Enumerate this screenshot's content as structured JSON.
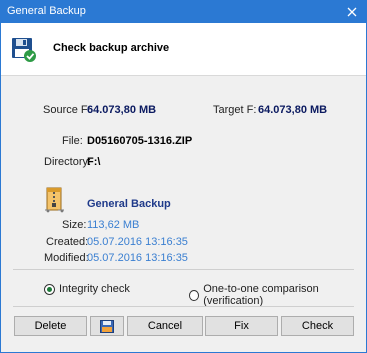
{
  "window": {
    "title": "General Backup"
  },
  "header": {
    "title": "Check backup archive"
  },
  "summary": {
    "source_label": "Source F:",
    "source_value": "64.073,80 MB",
    "target_label": "Target F:",
    "target_value": "64.073,80 MB",
    "file_label": "File:",
    "file_value": "D05160705-1316.ZIP",
    "directory_label": "Directory:",
    "directory_value": "F:\\"
  },
  "archive": {
    "name": "General Backup",
    "size_label": "Size:",
    "size_value": "113,62 MB",
    "created_label": "Created:",
    "created_value": "05.07.2016 13:16:35",
    "modified_label": "Modified:",
    "modified_value": "05.07.2016 13:16:35"
  },
  "options": {
    "integrity_label": "Integrity check",
    "comparison_label": "One-to-one comparison (verification)",
    "selected": "integrity"
  },
  "buttons": {
    "delete": "Delete",
    "cancel": "Cancel",
    "fix": "Fix",
    "check": "Check"
  },
  "icons": {
    "close": "close-icon",
    "header": "floppy-check-icon",
    "archive": "archive-zip-icon",
    "save": "floppy-icon"
  }
}
